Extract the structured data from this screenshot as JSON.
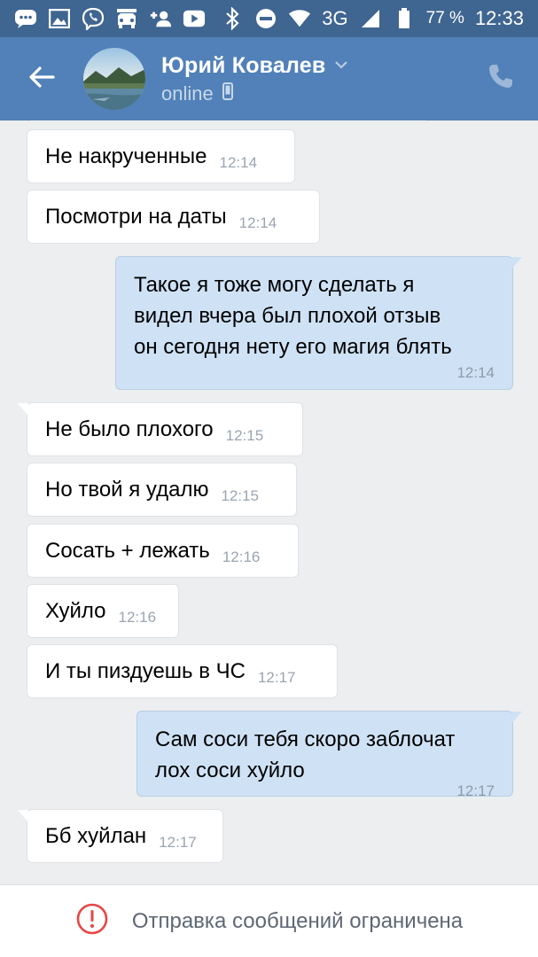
{
  "status_bar": {
    "network_type": "3G",
    "battery_percent": "77 %",
    "time": "12:33",
    "icons": [
      "message-bubble-icon",
      "image-icon",
      "viber-icon",
      "car-icon",
      "add-contact-icon",
      "youtube-icon",
      "bluetooth-icon",
      "do-not-disturb-icon",
      "wifi-icon",
      "signal-icon",
      "battery-icon"
    ]
  },
  "header": {
    "contact_name": "Юрий Ковалев",
    "contact_status": "online",
    "icons": [
      "back-arrow-icon",
      "chevron-down-icon",
      "mobile-phone-icon",
      "phone-icon"
    ]
  },
  "messages": [
    {
      "direction": "in",
      "text": "Не накрученные",
      "time": "12:14"
    },
    {
      "direction": "in",
      "text": "Посмотри на даты",
      "time": "12:14"
    },
    {
      "direction": "out",
      "text": "Такое я тоже могу сделать я\nвидел вчера был плохой отзыв\nон сегодня нету его магия блять",
      "time": "12:14"
    },
    {
      "direction": "in",
      "text": "Не было плохого",
      "time": "12:15"
    },
    {
      "direction": "in",
      "text": "Но твой я удалю",
      "time": "12:15"
    },
    {
      "direction": "in",
      "text": "Сосать + лежать",
      "time": "12:16"
    },
    {
      "direction": "in",
      "text": "Хуйло",
      "time": "12:16"
    },
    {
      "direction": "in",
      "text": "И ты пиздуешь в ЧС",
      "time": "12:17"
    },
    {
      "direction": "out",
      "text": "Сам соси тебя скоро заблочат\nлох соси хуйло",
      "time": "12:17"
    },
    {
      "direction": "in",
      "text": "Бб хуйлан",
      "time": "12:17"
    }
  ],
  "restriction": {
    "text": "Отправка сообщений ограничена",
    "icon": "alert-circle-icon",
    "icon_color": "#e64646"
  },
  "colors": {
    "status_bar": "#3f6591",
    "header": "#5181b8",
    "background": "#edeef0",
    "incoming_bubble": "#ffffff",
    "outgoing_bubble": "#cfe2f5"
  }
}
